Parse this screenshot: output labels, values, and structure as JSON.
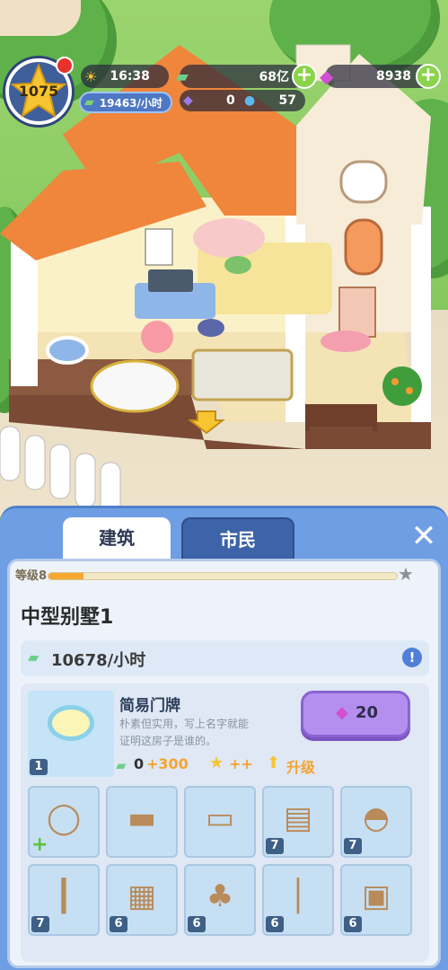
{
  "hud": {
    "level": "1075",
    "time": "16:38",
    "rate": "19463/小时",
    "cash": "68亿",
    "gems": "8938",
    "stat_a": "0",
    "stat_b": "57"
  },
  "tabs": [
    {
      "label": "建筑",
      "active": true
    },
    {
      "label": "市民",
      "active": false
    }
  ],
  "building": {
    "level_label": "等级8",
    "level_progress": 0.1,
    "name": "中型别墅1",
    "income": "10678/小时"
  },
  "item": {
    "name": "简易门牌",
    "description_line1": "朴素但实用，写上名字就能",
    "description_line2": "证明这房子是谁的。",
    "level": "1",
    "price": "20",
    "cash_bonus_prefix": "0",
    "cash_bonus": "+300",
    "star_bonus": "++",
    "upgrade_label": "升级"
  },
  "grid": [
    {
      "name": "sign-item",
      "count": "",
      "plus": true
    },
    {
      "name": "bed-item",
      "count": ""
    },
    {
      "name": "kitchen-counter-item",
      "count": ""
    },
    {
      "name": "desk-item",
      "count": "7"
    },
    {
      "name": "toilet-item",
      "count": "7"
    },
    {
      "name": "shower-item",
      "count": "7"
    },
    {
      "name": "dresser-item",
      "count": "6"
    },
    {
      "name": "orange-tree-item",
      "count": "6"
    },
    {
      "name": "floor-lamp-item",
      "count": "6"
    },
    {
      "name": "wall-calendar-item",
      "count": "6"
    }
  ],
  "colors": {
    "panel_blue": "#6e9ee4",
    "tab_active": "#ffffff",
    "tab_inactive": "#3d63a8",
    "price_button": "#b48ff0",
    "accent_orange": "#f4a431",
    "level_star": "#f7c531"
  }
}
